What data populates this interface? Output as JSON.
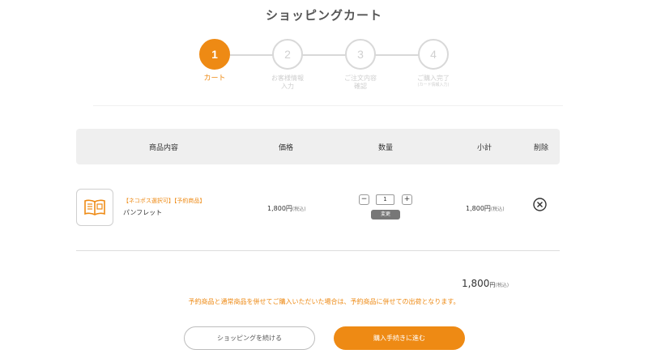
{
  "page": {
    "title": "ショッピングカート"
  },
  "steps": [
    {
      "number": "1",
      "label": "カート",
      "sub": ""
    },
    {
      "number": "2",
      "label": "お客様情報入力",
      "sub": ""
    },
    {
      "number": "3",
      "label": "ご注文内容確認",
      "sub": ""
    },
    {
      "number": "4",
      "label": "ご購入完了",
      "sub": "(カード情報入力)"
    }
  ],
  "table": {
    "headers": {
      "item": "商品内容",
      "price": "価格",
      "qty": "数量",
      "subtotal": "小計",
      "delete": "削除"
    }
  },
  "items": [
    {
      "tag": "【ネコポス選択可】【予約商品】",
      "name": "パンフレット",
      "price": "1,800",
      "price_unit": "円",
      "tax": "(税込)",
      "quantity": "1",
      "minus": "−",
      "plus": "+",
      "change_label": "変更",
      "subtotal": "1,800",
      "subtotal_unit": "円",
      "subtotal_tax": "(税込)",
      "thumb_icon": "book-icon",
      "delete_icon": "close-circle-icon"
    }
  ],
  "total": {
    "amount": "1,800",
    "unit": "円",
    "tax": "(税込)"
  },
  "notice": "予約商品と通常商品を併せてご購入いただいた場合は、予約商品に併せての出荷となります。",
  "buttons": {
    "continue": "ショッピングを続ける",
    "checkout": "購入手続きに進む"
  },
  "colors": {
    "accent": "#ee8a14",
    "inactive": "#d8d8d8"
  }
}
